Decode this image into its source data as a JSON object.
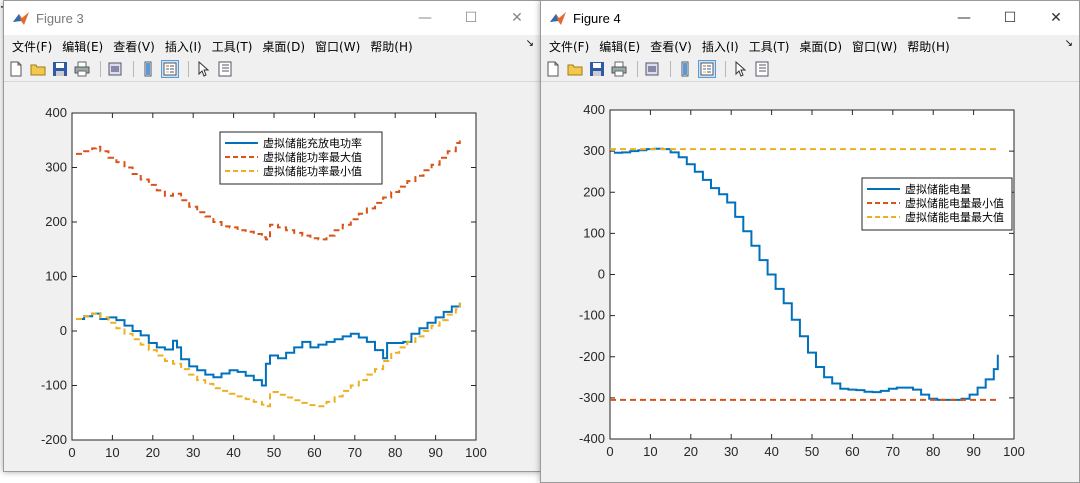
{
  "figure3": {
    "title": "Figure 3",
    "menu": [
      "文件(F)",
      "编辑(E)",
      "查看(V)",
      "插入(I)",
      "工具(T)",
      "桌面(D)",
      "窗口(W)",
      "帮助(H)"
    ],
    "window_controls": {
      "minimize": "—",
      "maximize": "☐",
      "close": "✕"
    },
    "dock_arrow": "↘",
    "colors": {
      "series1": "#0072BD",
      "series2": "#D95319",
      "series3": "#EDB120"
    },
    "chart_data": {
      "type": "line",
      "xlim": [
        0,
        100
      ],
      "ylim": [
        -200,
        400
      ],
      "xticks": [
        "0",
        "10",
        "20",
        "30",
        "40",
        "50",
        "60",
        "70",
        "80",
        "90",
        "100"
      ],
      "yticks": [
        "-200",
        "-100",
        "0",
        "100",
        "200",
        "300",
        "400"
      ],
      "legend_position": "top-right",
      "series": [
        {
          "name": "虚拟储能充放电功率",
          "style": "solid",
          "step": true,
          "x": [
            1,
            3,
            5,
            7,
            9,
            11,
            13,
            15,
            17,
            19,
            21,
            23,
            25,
            26,
            27,
            29,
            31,
            33,
            35,
            37,
            39,
            41,
            43,
            45,
            47,
            48,
            49,
            51,
            53,
            55,
            57,
            59,
            61,
            63,
            65,
            67,
            69,
            71,
            73,
            75,
            77,
            78,
            80,
            82,
            84,
            86,
            88,
            90,
            92,
            94,
            96
          ],
          "y": [
            22,
            27,
            32,
            22,
            25,
            20,
            10,
            0,
            -8,
            -22,
            -30,
            -34,
            -18,
            -30,
            -52,
            -65,
            -72,
            -80,
            -85,
            -78,
            -72,
            -75,
            -82,
            -90,
            -100,
            -60,
            -45,
            -50,
            -40,
            -30,
            -20,
            -30,
            -25,
            -20,
            -15,
            -10,
            -5,
            -12,
            -20,
            -35,
            -50,
            -22,
            -22,
            -20,
            -5,
            5,
            15,
            25,
            35,
            45,
            52
          ]
        },
        {
          "name": "虚拟储能功率最大值",
          "style": "dashed",
          "step": true,
          "x": [
            1,
            3,
            5,
            6,
            7,
            9,
            11,
            13,
            15,
            17,
            19,
            21,
            23,
            25,
            27,
            29,
            31,
            33,
            35,
            37,
            39,
            41,
            43,
            45,
            47,
            48,
            49,
            51,
            53,
            55,
            57,
            59,
            61,
            63,
            65,
            67,
            69,
            71,
            73,
            75,
            77,
            79,
            81,
            83,
            85,
            87,
            89,
            91,
            93,
            95,
            96
          ],
          "y": [
            325,
            330,
            335,
            338,
            330,
            318,
            310,
            300,
            288,
            278,
            268,
            258,
            248,
            252,
            240,
            228,
            218,
            210,
            200,
            192,
            190,
            185,
            182,
            178,
            172,
            168,
            195,
            190,
            185,
            180,
            175,
            170,
            168,
            175,
            185,
            195,
            205,
            215,
            225,
            235,
            245,
            255,
            265,
            275,
            285,
            295,
            305,
            318,
            330,
            345,
            355
          ]
        },
        {
          "name": "虚拟储能功率最小值",
          "style": "dashed",
          "step": true,
          "x": [
            1,
            3,
            5,
            6,
            7,
            9,
            11,
            13,
            15,
            17,
            19,
            21,
            23,
            25,
            27,
            29,
            31,
            33,
            35,
            37,
            39,
            41,
            43,
            45,
            47,
            48,
            49,
            51,
            53,
            55,
            57,
            59,
            61,
            63,
            65,
            67,
            69,
            71,
            73,
            75,
            77,
            79,
            81,
            83,
            85,
            87,
            89,
            91,
            93,
            95,
            96
          ],
          "y": [
            22,
            27,
            32,
            33,
            25,
            15,
            5,
            -5,
            -15,
            -25,
            -35,
            -45,
            -55,
            -60,
            -70,
            -80,
            -90,
            -97,
            -105,
            -110,
            -115,
            -120,
            -125,
            -130,
            -135,
            -138,
            -112,
            -117,
            -122,
            -127,
            -132,
            -136,
            -138,
            -130,
            -120,
            -110,
            -100,
            -90,
            -80,
            -70,
            -55,
            -40,
            -30,
            -20,
            -10,
            0,
            10,
            20,
            30,
            40,
            52
          ]
        }
      ]
    }
  },
  "figure4": {
    "title": "Figure 4",
    "menu": [
      "文件(F)",
      "编辑(E)",
      "查看(V)",
      "插入(I)",
      "工具(T)",
      "桌面(D)",
      "窗口(W)",
      "帮助(H)"
    ],
    "window_controls": {
      "minimize": "—",
      "maximize": "☐",
      "close": "✕"
    },
    "dock_arrow": "↘",
    "colors": {
      "series1": "#0072BD",
      "series2": "#D95319",
      "series3": "#EDB120"
    },
    "chart_data": {
      "type": "line",
      "xlim": [
        0,
        100
      ],
      "ylim": [
        -400,
        400
      ],
      "xticks": [
        "0",
        "10",
        "20",
        "30",
        "40",
        "50",
        "60",
        "70",
        "80",
        "90",
        "100"
      ],
      "yticks": [
        "-400",
        "-300",
        "-200",
        "-100",
        "0",
        "100",
        "200",
        "300",
        "400"
      ],
      "legend_position": "right",
      "series": [
        {
          "name": "虚拟储能电量",
          "style": "solid",
          "step": true,
          "x": [
            1,
            3,
            5,
            7,
            9,
            11,
            13,
            15,
            17,
            19,
            21,
            23,
            25,
            27,
            29,
            31,
            33,
            35,
            37,
            39,
            41,
            43,
            45,
            47,
            49,
            51,
            53,
            55,
            57,
            59,
            61,
            63,
            65,
            67,
            69,
            71,
            73,
            75,
            77,
            79,
            81,
            83,
            85,
            87,
            89,
            91,
            93,
            95,
            96
          ],
          "y": [
            296,
            297,
            300,
            302,
            305,
            306,
            305,
            297,
            285,
            268,
            250,
            230,
            210,
            195,
            175,
            140,
            105,
            70,
            35,
            0,
            -35,
            -70,
            -110,
            -150,
            -190,
            -225,
            -250,
            -265,
            -278,
            -280,
            -281,
            -285,
            -286,
            -283,
            -278,
            -275,
            -275,
            -280,
            -292,
            -302,
            -305,
            -305,
            -305,
            -302,
            -292,
            -275,
            -255,
            -230,
            -195
          ]
        },
        {
          "name": "虚拟储能电量最小值",
          "style": "dashed",
          "x": [
            0,
            96
          ],
          "y": [
            -305,
            -305
          ]
        },
        {
          "name": "虚拟储能电量最大值",
          "style": "dashed",
          "x": [
            0,
            96
          ],
          "y": [
            305,
            305
          ]
        }
      ]
    }
  }
}
